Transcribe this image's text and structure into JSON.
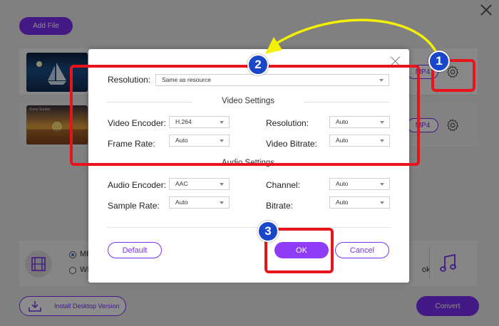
{
  "app": {
    "add_file_label": "Add File",
    "rows": [
      {
        "format_label": "MP4"
      },
      {
        "format_label": "MP4"
      }
    ],
    "thumb2_caption": "Snow Sunset",
    "bottom": {
      "option_video": "MP",
      "option_audio": "WI",
      "option_right": "ok"
    },
    "install_label": "Install Desktop Version",
    "convert_label": "Convert"
  },
  "dialog": {
    "resolution_label": "Resolution:",
    "resolution_value": "Same as resource",
    "video_section": "Video Settings",
    "video_encoder_label": "Video Encoder:",
    "video_encoder_value": "H.264",
    "video_resolution_label": "Resolution:",
    "video_resolution_value": "Auto",
    "frame_rate_label": "Frame Rate:",
    "frame_rate_value": "Auto",
    "video_bitrate_label": "Video Bitrate:",
    "video_bitrate_value": "Auto",
    "audio_section": "Audio Settings",
    "audio_encoder_label": "Audio Encoder:",
    "audio_encoder_value": "AAC",
    "channel_label": "Channel:",
    "channel_value": "Auto",
    "sample_rate_label": "Sample Rate:",
    "sample_rate_value": "Auto",
    "bitrate_label": "Bitrate:",
    "bitrate_value": "Auto",
    "default_label": "Default",
    "ok_label": "OK",
    "cancel_label": "Cancel"
  },
  "annotations": {
    "badge1": "1",
    "badge2": "2",
    "badge3": "3",
    "highlight_color": "#e8141c",
    "arrow_color": "#f3f000",
    "badge_color": "#1a47c9"
  },
  "theme": {
    "accent": "#7b2ff2"
  }
}
